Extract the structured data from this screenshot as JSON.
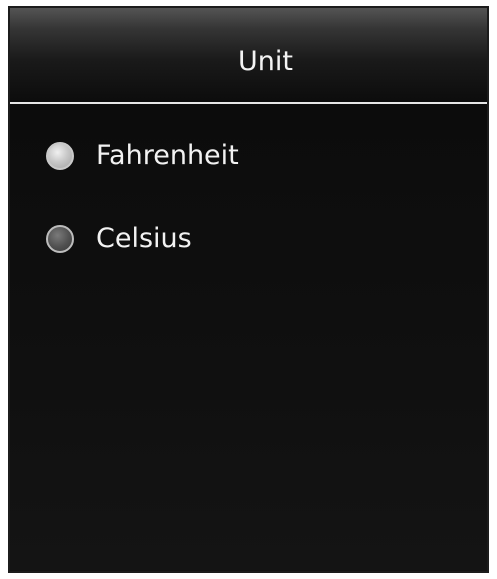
{
  "header": {
    "title": "Unit"
  },
  "unit_options": [
    {
      "label": "Fahrenheit",
      "selected": true
    },
    {
      "label": "Celsius",
      "selected": false
    }
  ],
  "colors": {
    "background": "#0d0d0d",
    "text": "#f2f2f2",
    "divider": "#e6e6e6"
  }
}
